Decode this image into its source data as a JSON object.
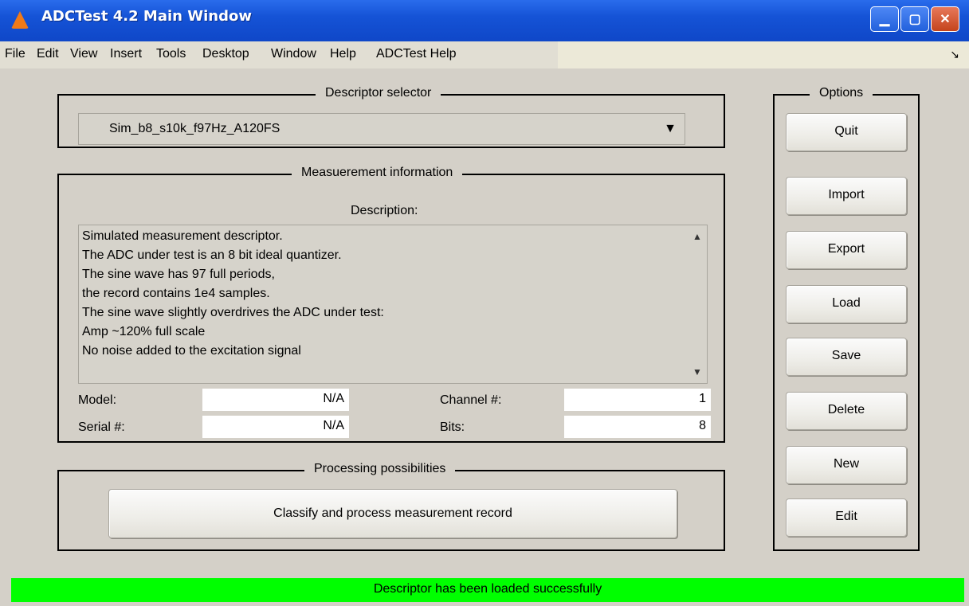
{
  "window": {
    "title": "ADCTest 4.2 Main Window",
    "minimize_icon": "minimize-icon",
    "maximize_icon": "maximize-icon",
    "close_icon": "close-icon"
  },
  "menubar": {
    "items": [
      "File",
      "Edit",
      "View",
      "Insert",
      "Tools",
      "Desktop",
      "Window",
      "Help",
      "ADCTest Help"
    ],
    "dock_arrow": "↘"
  },
  "descriptor_selector": {
    "title": "Descriptor selector",
    "selected": "Sim_b8_s10k_f97Hz_A120FS"
  },
  "measurement": {
    "title": "Measuerement information",
    "description_label": "Description:",
    "description_lines": [
      "Simulated measurement descriptor.",
      "The ADC under test is an 8 bit ideal quantizer.",
      "The sine wave has 97 full periods,",
      "the record contains 1e4 samples.",
      "The sine wave slightly overdrives the ADC under test:",
      "Amp ~120% full scale",
      "No noise added to the excitation signal"
    ],
    "model_label": "Model:",
    "model_value": "N/A",
    "serial_label": "Serial #:",
    "serial_value": "N/A",
    "channel_label": "Channel #:",
    "channel_value": "1",
    "bits_label": "Bits:",
    "bits_value": "8"
  },
  "processing": {
    "title": "Processing possibilities",
    "classify_button": "Classify and process measurement record"
  },
  "options": {
    "title": "Options",
    "buttons": [
      "Quit",
      "Import",
      "Export",
      "Load",
      "Save",
      "Delete",
      "New",
      "Edit"
    ]
  },
  "status": {
    "text": "Descriptor has been loaded successfully",
    "color": "#00ff00"
  }
}
